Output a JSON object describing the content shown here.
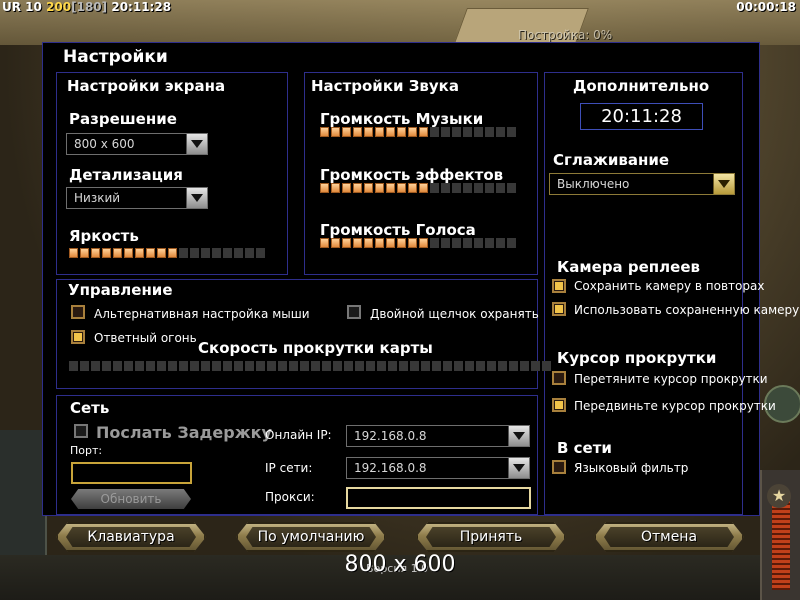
{
  "hud": {
    "faction": "UR",
    "level": "10",
    "money": "200",
    "power": "[180]",
    "clock": "20:11:28",
    "timer": "00:00:18",
    "build_status": "Постройка: 0%"
  },
  "dialog": {
    "title": "Настройки"
  },
  "screen": {
    "title": "Настройки экрана",
    "resolution_label": "Разрешение",
    "resolution_value": "800 x 600",
    "detail_label": "Детализация",
    "detail_value": "Низкий",
    "brightness_label": "Яркость",
    "brightness_level": 10,
    "brightness_max": 18
  },
  "sound": {
    "title": "Настройки Звука",
    "music_label": "Громкость Музыки",
    "music_level": 10,
    "effects_label": "Громкость эффектов",
    "effects_level": 10,
    "voice_label": "Громкость Голоса",
    "voice_level": 10,
    "slider_max": 18
  },
  "extra": {
    "title": "Дополнительно",
    "clock": "20:11:28",
    "antialias_label": "Сглаживание",
    "antialias_value": "Выключено",
    "replay_cam_title": "Камера реплеев",
    "save_cam": "Сохранить камеру в повторах",
    "use_saved_cam": "Использовать сохраненную камеру",
    "scroll_cursor_title": "Курсор прокрутки",
    "drag_cursor": "Перетяните курсор прокрутки",
    "move_cursor": "Передвиньте курсор прокрутки",
    "online_title": "В сети",
    "lang_filter": "Языковый фильтр"
  },
  "control": {
    "title": "Управление",
    "alt_mouse": "Альтернативная настройка мыши",
    "double_click": "Двойной щелчок охранять",
    "return_fire": "Ответный огонь",
    "scroll_speed": "Скорость прокрутки карты",
    "scroll_level": 0,
    "scroll_max": 44
  },
  "network": {
    "title": "Сеть",
    "send_delay": "Послать Задержку",
    "port_label": "Порт:",
    "port_value": "",
    "refresh": "Обновить",
    "online_ip_label": "Онлайн IP:",
    "online_ip": "192.168.0.8",
    "lan_ip_label": "IP сети:",
    "lan_ip": "192.168.0.8",
    "proxy_label": "Прокси:",
    "proxy_value": ""
  },
  "buttons": {
    "keyboard": "Клавиатура",
    "defaults": "По умолчанию",
    "accept": "Принять",
    "cancel": "Отмена"
  },
  "overlay": {
    "resolution": "800 x 600",
    "version": "Версия 1.0"
  },
  "colors": {
    "panel_border": "#2e2e8c",
    "accent": "#f2c44a",
    "slider_on": "#e08a3c"
  }
}
